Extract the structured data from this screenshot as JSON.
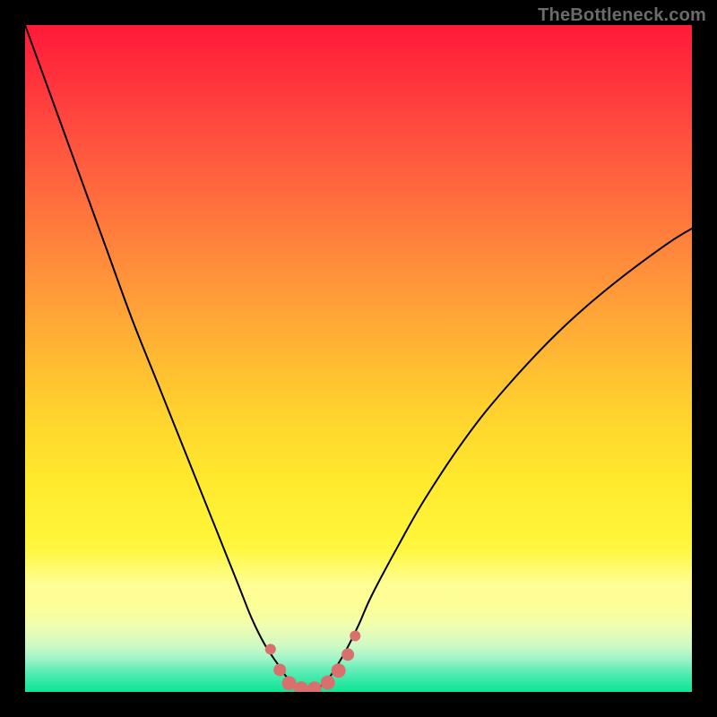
{
  "watermark": "TheBottleneck.com",
  "colors": {
    "curve": "#000000",
    "marker": "#d8716e",
    "frame_bg": "#000000"
  },
  "chart_data": {
    "type": "line",
    "title": "",
    "xlabel": "",
    "ylabel": "",
    "xlim": [
      0,
      100
    ],
    "ylim": [
      0,
      100
    ],
    "grid": false,
    "legend": false,
    "series": [
      {
        "name": "bottleneck-curve",
        "x": [
          0,
          4,
          8,
          12,
          16,
          20,
          24,
          28,
          32,
          34,
          36,
          38,
          39,
          40,
          41,
          42,
          43,
          44,
          45,
          46,
          48,
          50,
          52,
          56,
          60,
          66,
          72,
          80,
          88,
          96,
          100
        ],
        "y": [
          100,
          89,
          78,
          67,
          56,
          46,
          36,
          26,
          16,
          11,
          7,
          4,
          2.5,
          1.4,
          0.7,
          0.4,
          0.4,
          0.7,
          1.4,
          2.7,
          6,
          10,
          14.5,
          22,
          29,
          38,
          45.5,
          54,
          61,
          67,
          69.5
        ],
        "stroke": "#000000",
        "stroke_width": 2
      }
    ],
    "markers": {
      "name": "bottom-nodes",
      "color": "#d8716e",
      "points": [
        {
          "x": 36.8,
          "y": 6.4,
          "r": 6
        },
        {
          "x": 38.2,
          "y": 3.3,
          "r": 7
        },
        {
          "x": 39.6,
          "y": 1.3,
          "r": 8
        },
        {
          "x": 41.4,
          "y": 0.5,
          "r": 8
        },
        {
          "x": 43.4,
          "y": 0.5,
          "r": 8
        },
        {
          "x": 45.4,
          "y": 1.4,
          "r": 8
        },
        {
          "x": 47.0,
          "y": 3.2,
          "r": 8
        },
        {
          "x": 48.4,
          "y": 5.6,
          "r": 7
        },
        {
          "x": 49.5,
          "y": 8.4,
          "r": 6
        }
      ]
    }
  }
}
